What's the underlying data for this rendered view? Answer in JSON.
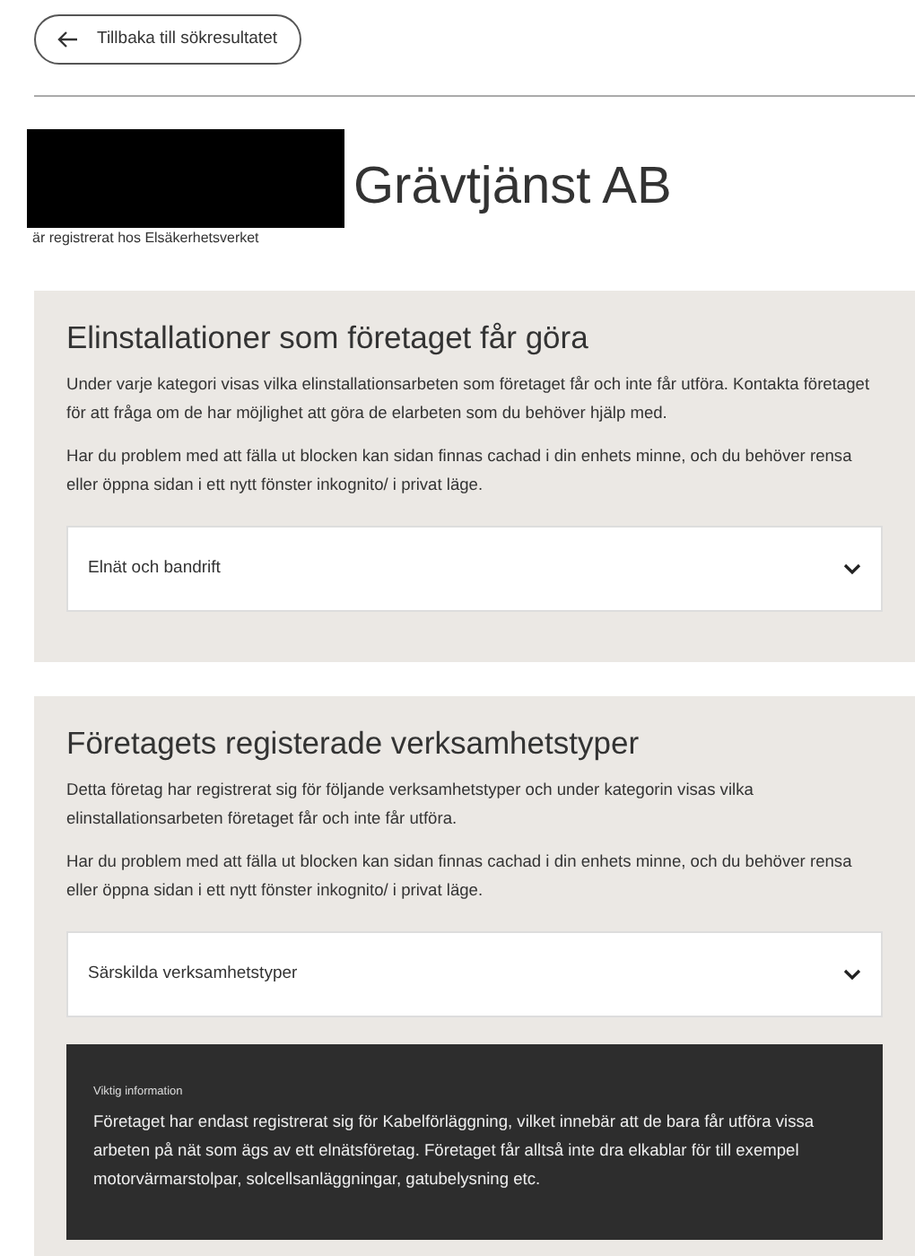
{
  "back_button": {
    "label": "Tillbaka till sökresultatet"
  },
  "company": {
    "name": "Grävtjänst AB",
    "subtitle": "är registrerat hos Elsäkerhetsverket"
  },
  "sections": [
    {
      "heading": "Elinstallationer som företaget får göra",
      "paragraphs": [
        "Under varje kategori visas vilka elinstallationsarbeten som företaget får och inte får utföra. Kontakta företaget för att fråga om de har möjlighet att göra de elarbeten som du behöver hjälp med.",
        "Har du problem med att fälla ut blocken kan sidan finnas cachad i din enhets minne, och du behöver rensa eller öppna sidan i ett nytt fönster inkognito/ i privat läge."
      ],
      "accordions": [
        {
          "label": "Elnät och bandrift",
          "expanded": false
        }
      ]
    },
    {
      "heading": "Företagets registerade verksamhetstyper",
      "paragraphs": [
        "Detta företag har registrerat sig för följande verksamhetstyper och under kategorin visas vilka elinstallationsarbeten företaget får och inte får utföra.",
        "Har du problem med att fälla ut blocken kan sidan finnas cachad i din enhets minne, och du behöver rensa eller öppna sidan i ett nytt fönster inkognito/ i privat läge."
      ],
      "accordions": [
        {
          "label": "Särskilda verksamhetstyper",
          "expanded": false
        }
      ],
      "info_box": {
        "title": "Viktig information",
        "text": "Företaget har endast registrerat sig för Kabelförläggning, vilket innebär att de bara får utföra vissa arbeten på nät som ägs av ett elnätsföretag. Företaget får alltså inte dra elkablar för till exempel motorvärmarstolpar, solcellsanläggningar, gatubelysning etc."
      }
    }
  ]
}
